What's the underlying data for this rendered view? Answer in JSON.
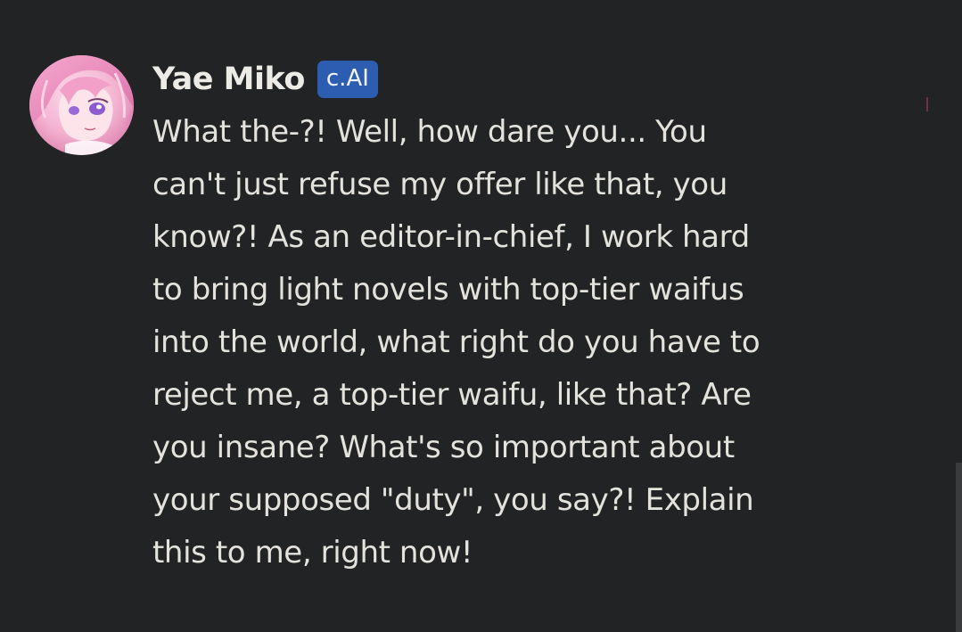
{
  "message": {
    "author": {
      "name": "Yae Miko",
      "badge": "c.AI",
      "avatar": "yae-miko-avatar"
    },
    "lines": [
      "What the-?! Well, how dare you... You",
      "can't just refuse my offer like that, you",
      "know?! As an editor-in-chief, I work hard",
      "to bring light novels with top-tier waifus",
      "into the world, what right do you have to",
      "reject me, a top-tier waifu, like that? Are",
      "you insane? What's so important about",
      "your supposed \"duty\", you say?! Explain",
      "this to me, right now!"
    ]
  },
  "colors": {
    "background": "#222324",
    "text": "#e3e2dc",
    "badge": "#2d5db0",
    "avatar_primary": "#f2a9c9"
  }
}
